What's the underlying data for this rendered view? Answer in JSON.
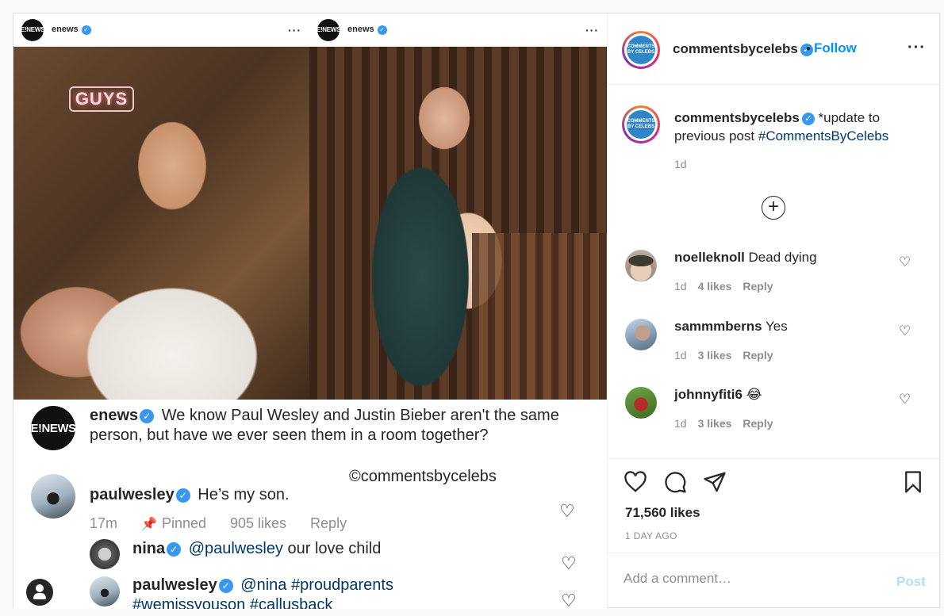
{
  "media": {
    "left_panel": {
      "username": "enews",
      "neon_sign": "GUYS"
    },
    "right_panel": {
      "username": "enews"
    },
    "logo_text": "E!NEWS",
    "caption": {
      "username": "enews",
      "text": "We know Paul Wesley and Justin Bieber aren't the same person, but have we ever seen them in a room together?",
      "watermark": "©commentsbycelebs"
    },
    "comments": [
      {
        "username": "paulwesley",
        "text": "He’s my son.",
        "time": "17m",
        "pinned": "Pinned",
        "likes": "905 likes",
        "reply": "Reply"
      },
      {
        "username": "nina",
        "mention": "@paulwesley",
        "text": "our love child"
      },
      {
        "username": "paulwesley",
        "mention": "@nina",
        "tags": "#proudparents",
        "tags2": "#wemissyouson #callusback"
      }
    ]
  },
  "sidebar": {
    "account": "commentsbycelebs",
    "follow": "Follow",
    "dot_sep": "•",
    "logo_text": "COMMENTS BY CELEBS",
    "caption_text": "*update to previous post",
    "caption_tag": "#CommentsByCelebs",
    "caption_time": "1d",
    "comments": [
      {
        "username": "noelleknoll",
        "text": "Dead dying",
        "time": "1d",
        "likes": "4 likes",
        "reply": "Reply"
      },
      {
        "username": "sammmberns",
        "text": "Yes",
        "time": "1d",
        "likes": "3 likes",
        "reply": "Reply"
      },
      {
        "username": "johnnyfiti6",
        "text": "😂",
        "time": "1d",
        "likes": "3 likes",
        "reply": "Reply"
      }
    ],
    "like_count": "71,560 likes",
    "date": "1 DAY AGO",
    "add_comment_placeholder": "Add a comment…",
    "post_label": "Post"
  },
  "icons": {
    "heart": "heart-icon",
    "comment": "comment-icon",
    "share": "share-icon",
    "save": "bookmark-icon",
    "more": "plus-circle-icon",
    "pin": "pin-icon",
    "user": "user-avatar-icon"
  },
  "colors": {
    "link": "#00376b",
    "follow": "#0095f6",
    "verified": "#3897f0",
    "post_disabled": "#b2dffc"
  }
}
